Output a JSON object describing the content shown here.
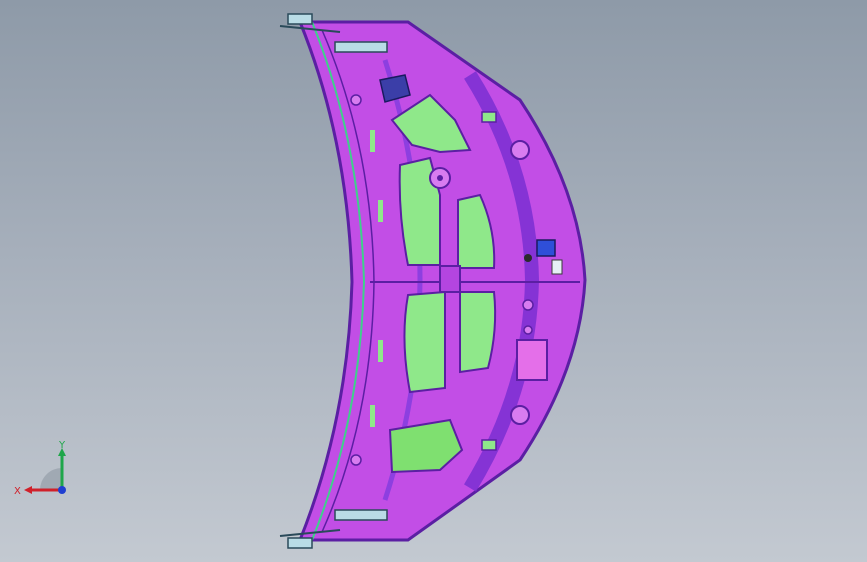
{
  "viewport": {
    "background_top": "#8e9aa8",
    "background_bottom": "#c3c9d1"
  },
  "model": {
    "body_color": "#c24ee6",
    "outline_color": "#5b1fa3",
    "rib_color": "#7a2fd1",
    "panel_color": "#8fe88a",
    "hinge_color": "#b9dce6",
    "label_patch_color": "#e46fe9"
  },
  "triad": {
    "x_label": "X",
    "y_label": "Y",
    "x_color": "#d0202a",
    "y_color": "#1fa64a",
    "z_color": "#1f3fd1"
  }
}
